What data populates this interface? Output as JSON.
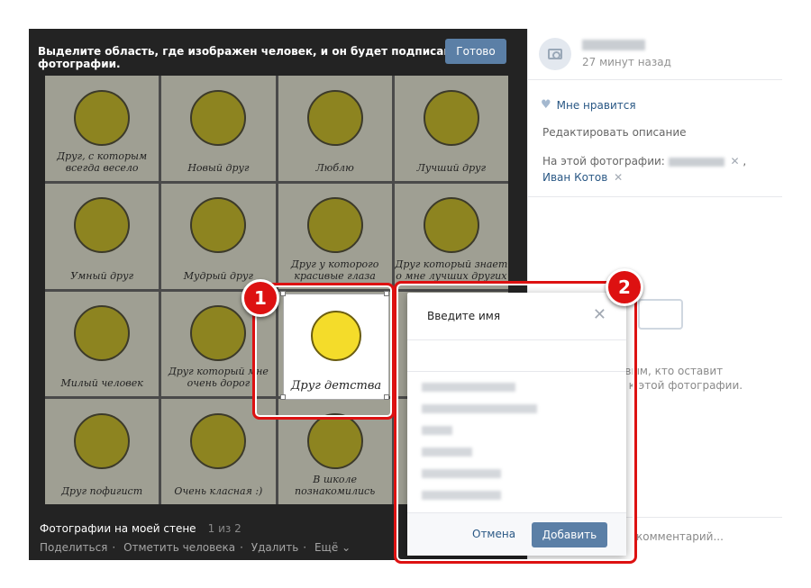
{
  "viewer": {
    "instruction": "Выделите область, где изображен человек, и он будет подписан на фотографии.",
    "done_button": "Готово",
    "grid_labels": [
      "Друг, с которым всегда весело",
      "Новый друг",
      "Люблю",
      "Лучший друг",
      "Умный друг",
      "Мудрый друг",
      "Друг у которого красивые глаза",
      "Друг который знает о мне лучших других",
      "Милый человек",
      "Друг который мне очень дорог",
      "",
      "",
      "Друг пофигист",
      "Очень класная :)",
      "В школе познакомились",
      ""
    ],
    "selected_label": "Друг детства",
    "album_title": "Фотографии на моей стене",
    "album_count": "1 из 2",
    "actions": [
      "Поделиться",
      "Отметить человека",
      "Удалить",
      "Ещё"
    ]
  },
  "sidebar": {
    "time": "27 минут назад",
    "like": "Мне нравится",
    "edit_description": "Редактировать описание",
    "on_photo_label": "На этой фотографии:",
    "tagged_person": "Иван Котов",
    "empty_text_line1": "евым, кто оставит",
    "empty_text_line2": "и к этой фотографии.",
    "comment_placeholder": "комментарий..."
  },
  "dialog": {
    "title": "Введите имя",
    "cancel": "Отмена",
    "add": "Добавить"
  },
  "markers": {
    "one": "1",
    "two": "2"
  },
  "colors": {
    "accent": "#5b7fa6",
    "annotation": "#dd1111"
  }
}
